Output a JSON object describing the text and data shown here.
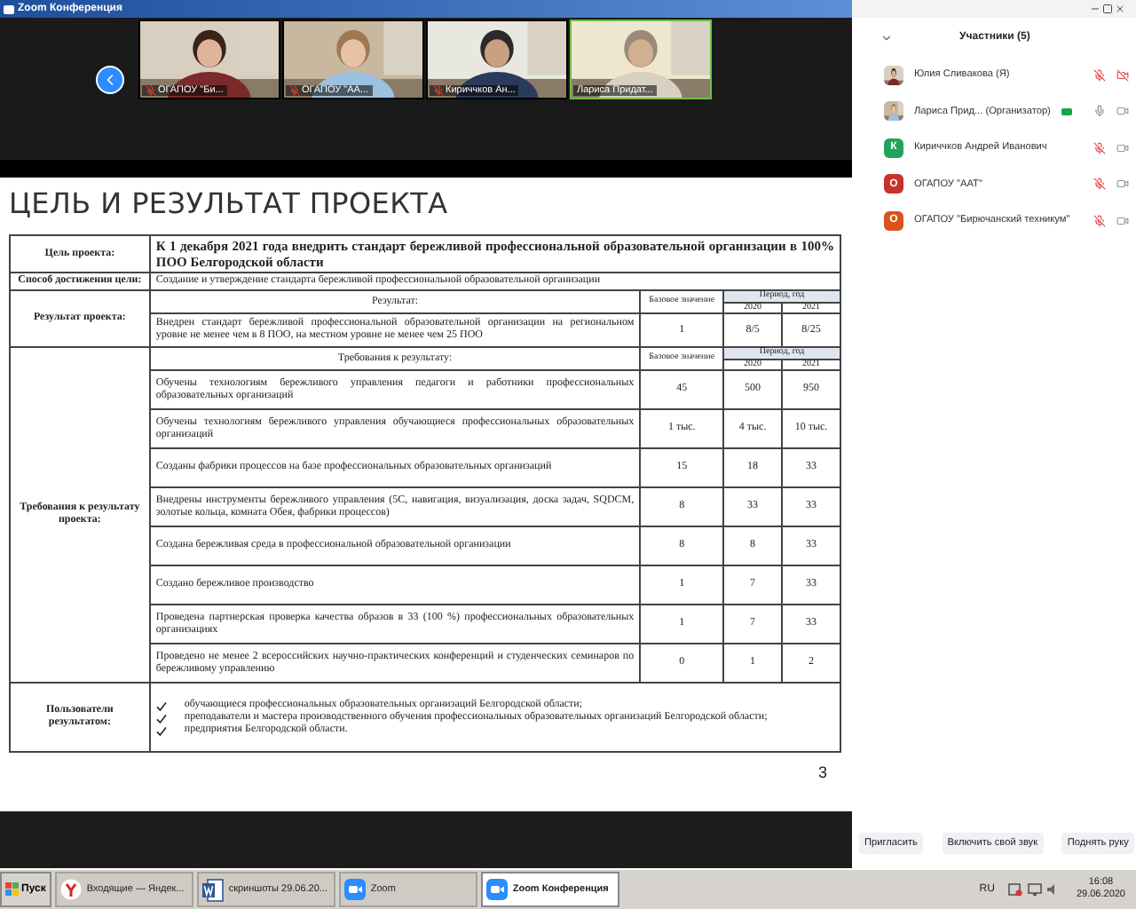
{
  "window": {
    "title": "Zoom Конференция"
  },
  "videos": [
    {
      "name": "ОГАПОУ \"Би...",
      "mic_muted": true,
      "speaking": false
    },
    {
      "name": "ОГАПОУ \"АА...",
      "mic_muted": true,
      "speaking": false
    },
    {
      "name": "Кириччков Ан...",
      "mic_muted": true,
      "speaking": false
    },
    {
      "name": "Лариса Придат...",
      "mic_muted": false,
      "speaking": true
    }
  ],
  "slide": {
    "title": "ЦЕЛЬ И РЕЗУЛЬТАТ ПРОЕКТА",
    "page": "3",
    "goal": {
      "label": "Цель проекта:",
      "text": "К 1 декабря 2021 года внедрить стандарт бережливой профессиональной образовательной организации в 100% ПОО Белгородской области"
    },
    "method": {
      "label": "Способ достижения цели:",
      "text": "Создание и утверждение стандарта бережливой профессиональной образовательной организации"
    },
    "result": {
      "label": "Результат проекта:",
      "header": "Результат:",
      "base_header": "Базовое значение",
      "period_header": "Период, год",
      "years": [
        "2020",
        "2021"
      ],
      "rows": [
        {
          "text": "Внедрен стандарт бережливой профессиональной образовательной организации на региональном уровне  не менее чем в 8 ПОО, на местном уровне  не менее чем 25 ПОО",
          "base": "1",
          "values": [
            "8/5",
            "8/25"
          ]
        }
      ]
    },
    "requirements": {
      "label": "Требования к результату проекта:",
      "header": "Требования к результату:",
      "base_header": "Базовое значение",
      "period_header": "Период, год",
      "years": [
        "2020",
        "2021"
      ],
      "rows": [
        {
          "text": "Обучены технологиям бережливого управления педагоги и работники профессиональных образовательных организаций",
          "base": "45",
          "values": [
            "500",
            "950"
          ]
        },
        {
          "text": "Обучены технологиям бережливого управления обучающиеся профессиональных образовательных организаций",
          "base": "1 тыс.",
          "values": [
            "4 тыс.",
            "10 тыс."
          ]
        },
        {
          "text": "Созданы фабрики процессов на базе профессиональных образовательных организаций",
          "base": "15",
          "values": [
            "18",
            "33"
          ]
        },
        {
          "text": "Внедрены инструменты бережливого управления (5С, навигация, визуализация, доска задач, SQDCM, золотые кольца, комната Обея, фабрики процессов)",
          "base": "8",
          "values": [
            "33",
            "33"
          ]
        },
        {
          "text": "Создана бережливая среда в профессиональной образовательной организации",
          "base": "8",
          "values": [
            "8",
            "33"
          ]
        },
        {
          "text": "Создано бережливое производство",
          "base": "1",
          "values": [
            "7",
            "33"
          ]
        },
        {
          "text": "Проведена партнерская проверка качества образов в 33 (100 %) профессиональных образовательных организациях",
          "base": "1",
          "values": [
            "7",
            "33"
          ]
        },
        {
          "text": "Проведено не менее 2 всероссийских научно-практических конференций и студенческих семинаров по бережливому управлению",
          "base": "0",
          "values": [
            "1",
            "2"
          ]
        }
      ]
    },
    "users": {
      "label": "Пользователи результатом:",
      "items": [
        "обучающиеся профессиональных образовательных организаций Белгородской области;",
        "преподаватели и мастера производственного обучения профессиональных образовательных организаций Белгородской области;",
        "предприятия Белгородской области."
      ]
    }
  },
  "participants": {
    "title": "Участники (5)",
    "items": [
      {
        "name": "Юлия Сливакова (Я)",
        "badge": false,
        "mic_muted": true,
        "video_muted": true
      },
      {
        "name": "Лариса Прид... (Организатор)",
        "badge": true,
        "mic_muted": false,
        "video_muted": false
      },
      {
        "name": "Кириччков Андрей Иванович",
        "avatar": {
          "kind": "letter",
          "letter": "К",
          "color": "#21a35a"
        },
        "badge": false,
        "mic_muted": true,
        "video_muted": false
      },
      {
        "name": "ОГАПОУ \"ААТ\"",
        "avatar": {
          "kind": "letter",
          "letter": "О",
          "color": "#c9302c"
        },
        "badge": false,
        "mic_muted": true,
        "video_muted": false
      },
      {
        "name": "ОГАПОУ \"Бирючанский техникум\"",
        "avatar": {
          "kind": "letter",
          "letter": "О",
          "color": "#d9541a"
        },
        "badge": false,
        "mic_muted": true,
        "video_muted": false
      }
    ]
  },
  "panel_buttons": [
    "Пригласить",
    "Включить свой звук",
    "Поднять руку"
  ],
  "taskbar": {
    "start": "Пуск",
    "tasks": [
      {
        "label": "Входящие — Яндек...",
        "kind": "browser",
        "selected": false
      },
      {
        "label": "скриншоты 29.06.20...",
        "kind": "document",
        "selected": false
      },
      {
        "label": "Zoom",
        "kind": "camera",
        "selected": false
      },
      {
        "label": "Zoom Конференция",
        "kind": "camera",
        "selected": true
      }
    ],
    "lang": "RU",
    "time": "16:08",
    "date": "29.06.2020"
  }
}
